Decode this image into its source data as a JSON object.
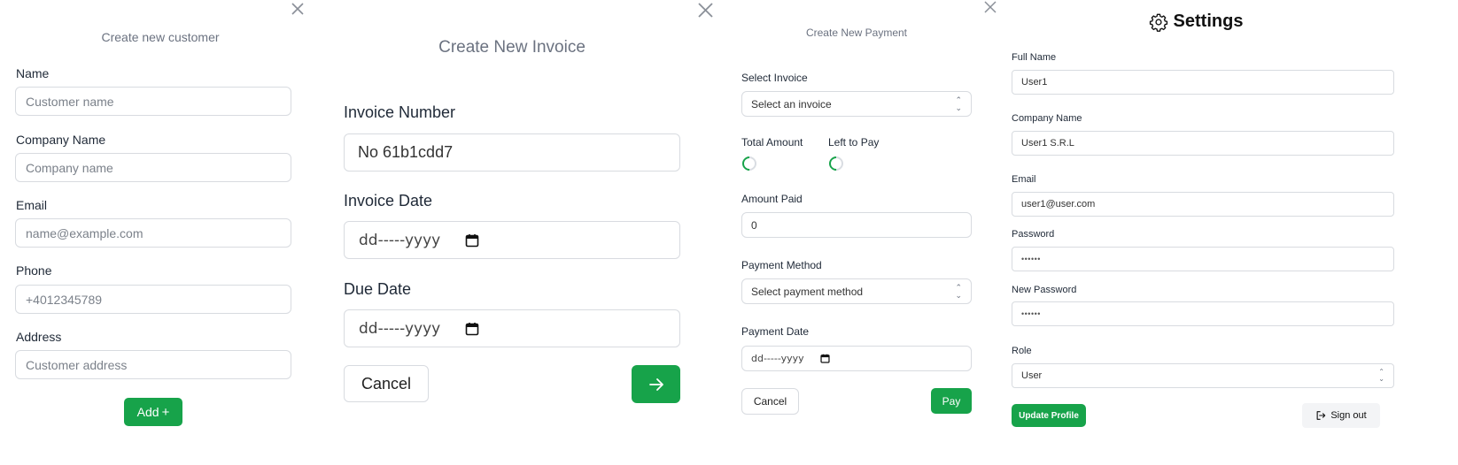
{
  "customer_form": {
    "title": "Create new customer",
    "fields": [
      {
        "label": "Name",
        "placeholder": "Customer name"
      },
      {
        "label": "Company Name",
        "placeholder": "Company name"
      },
      {
        "label": "Email",
        "placeholder": "name@example.com"
      },
      {
        "label": "Phone",
        "placeholder": "+4012345789"
      },
      {
        "label": "Address",
        "placeholder": "Customer address"
      }
    ],
    "add_label": "Add",
    "add_icon": "+"
  },
  "invoice_form": {
    "title": "Create New Invoice",
    "number_label": "Invoice Number",
    "number_value": "No 61b1cdd7",
    "date_label": "Invoice Date",
    "date_value": "dd-----yyyy",
    "due_label": "Due Date",
    "due_value": "dd-----yyyy",
    "cancel_label": "Cancel",
    "next_icon": "arrow-right-icon"
  },
  "payment_form": {
    "title": "Create New Payment",
    "invoice_label": "Select Invoice",
    "invoice_value": "Select an invoice",
    "total_label": "Total Amount",
    "left_label": "Left to Pay",
    "amount_label": "Amount Paid",
    "amount_value": "0",
    "method_label": "Payment Method",
    "method_value": "Select payment method",
    "date_label": "Payment Date",
    "date_value": "dd-----yyyy",
    "cancel_label": "Cancel",
    "pay_label": "Pay"
  },
  "settings": {
    "title": "Settings",
    "full_name_label": "Full Name",
    "full_name_value": "User1",
    "company_label": "Company Name",
    "company_value": "User1 S.R.L",
    "email_label": "Email",
    "email_value": "user1@user.com",
    "password_label": "Password",
    "password_value": "••••••",
    "new_password_label": "New Password",
    "new_password_value": "••••••",
    "role_label": "Role",
    "role_value": "User",
    "update_label": "Update Profile",
    "signout_label": "Sign out"
  },
  "colors": {
    "accent": "#17a34a",
    "border": "#d8dbe0",
    "muted": "#6b7280"
  }
}
